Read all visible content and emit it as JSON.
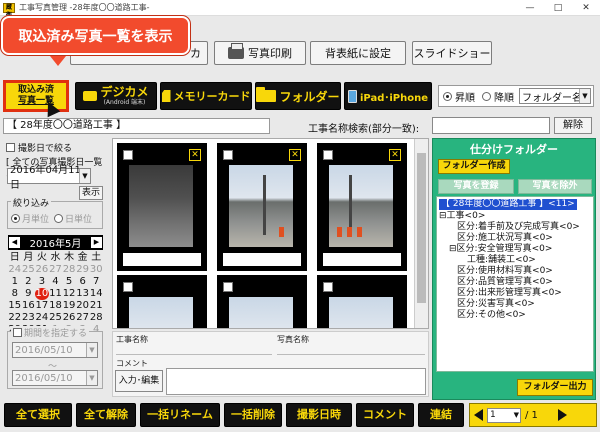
{
  "window": {
    "title": "工事写真管理 -28年度〇〇道路工事-",
    "icon_text": "蔵衛",
    "minimize": "—",
    "maximize": "□",
    "close": "✕"
  },
  "callout": {
    "text": "取込済み写真一覧を表示"
  },
  "toolbar_top": {
    "hidden_btn1": "カ",
    "print": "写真印刷",
    "spine": "背表紙に設定",
    "slideshow": "スライドショー"
  },
  "toolbar_second": {
    "import_line1": "取込み済",
    "import_line2": "写真一覧",
    "digicam": "デジカメ",
    "digicam_sub": "(Android 端末)",
    "memory_card": "メモリーカード",
    "folder": "フォルダー",
    "ipad": "iPad･iPhone",
    "sort_asc": "昇順",
    "sort_desc": "降順",
    "sort_field": "フォルダー名"
  },
  "folderbar": {
    "current": "【 28年度〇〇道路工事 】",
    "search_label": "工事名称検索(部分一致):",
    "search_value": "",
    "clear": "解除"
  },
  "leftpanel": {
    "narrow_by_date": "撮影日で絞る",
    "all_dates": "[ 全ての写真撮影日一覧 ]",
    "date_value": "2016年04月11日",
    "show": "表示",
    "filter_group": "絞り込み",
    "by_month": "月単位",
    "by_day": "日単位",
    "cal_title": "2016年5月",
    "cal_prev": "◀",
    "cal_next": "▶",
    "period": "期間を指定する",
    "from_date": "2016/05/10",
    "tilde": "〜",
    "to_date": "2016/05/10",
    "weekdays": [
      "日",
      "月",
      "火",
      "水",
      "木",
      "金",
      "土"
    ],
    "days": [
      "24",
      "25",
      "26",
      "27",
      "28",
      "29",
      "30",
      "1",
      "2",
      "3",
      "4",
      "5",
      "6",
      "7",
      "8",
      "9",
      "10",
      "11",
      "12",
      "13",
      "14",
      "15",
      "16",
      "17",
      "18",
      "19",
      "20",
      "21",
      "22",
      "23",
      "24",
      "25",
      "26",
      "27",
      "28",
      "29",
      "30",
      "31",
      "1",
      "2",
      "3",
      "4"
    ]
  },
  "info": {
    "project_name_label": "工事名称",
    "photo_name_label": "写真名称",
    "comment_label": "コメント",
    "edit_button": "入力･編集"
  },
  "rightpanel": {
    "title": "仕分けフォルダー",
    "create_folder": "フォルダー作成",
    "register_photo": "写真を登録",
    "remove_photo": "写真を除外",
    "export_folder": "フォルダー出力",
    "tree": [
      {
        "text": "【 28年度〇〇道路工事 】<11>",
        "selected": true
      },
      {
        "text": "工事<0>"
      },
      {
        "text": "区分:着手前及び完成写真<0>"
      },
      {
        "text": "区分:施工状況写真<0>"
      },
      {
        "text": "区分:安全管理写真<0>"
      },
      {
        "text": "工種:舗装工<0>"
      },
      {
        "text": "区分:使用材料写真<0>"
      },
      {
        "text": "区分:品質管理写真<0>"
      },
      {
        "text": "区分:出来形管理写真<0>"
      },
      {
        "text": "区分:災害写真<0>"
      },
      {
        "text": "区分:その他<0>"
      }
    ]
  },
  "bottombar": {
    "select_all": "全て選択",
    "deselect_all": "全て解除",
    "bulk_rename": "一括リネーム",
    "bulk_delete": "一括削除",
    "shot_datetime": "撮影日時",
    "comment": "コメント",
    "link": "連結",
    "page_current": "1",
    "page_total": "/ 1"
  },
  "colors": {
    "accent_yellow": "#f8d70a",
    "folder_green": "#28b47f",
    "callout_red": "#f24b2d",
    "selection_blue": "#2050d0"
  }
}
